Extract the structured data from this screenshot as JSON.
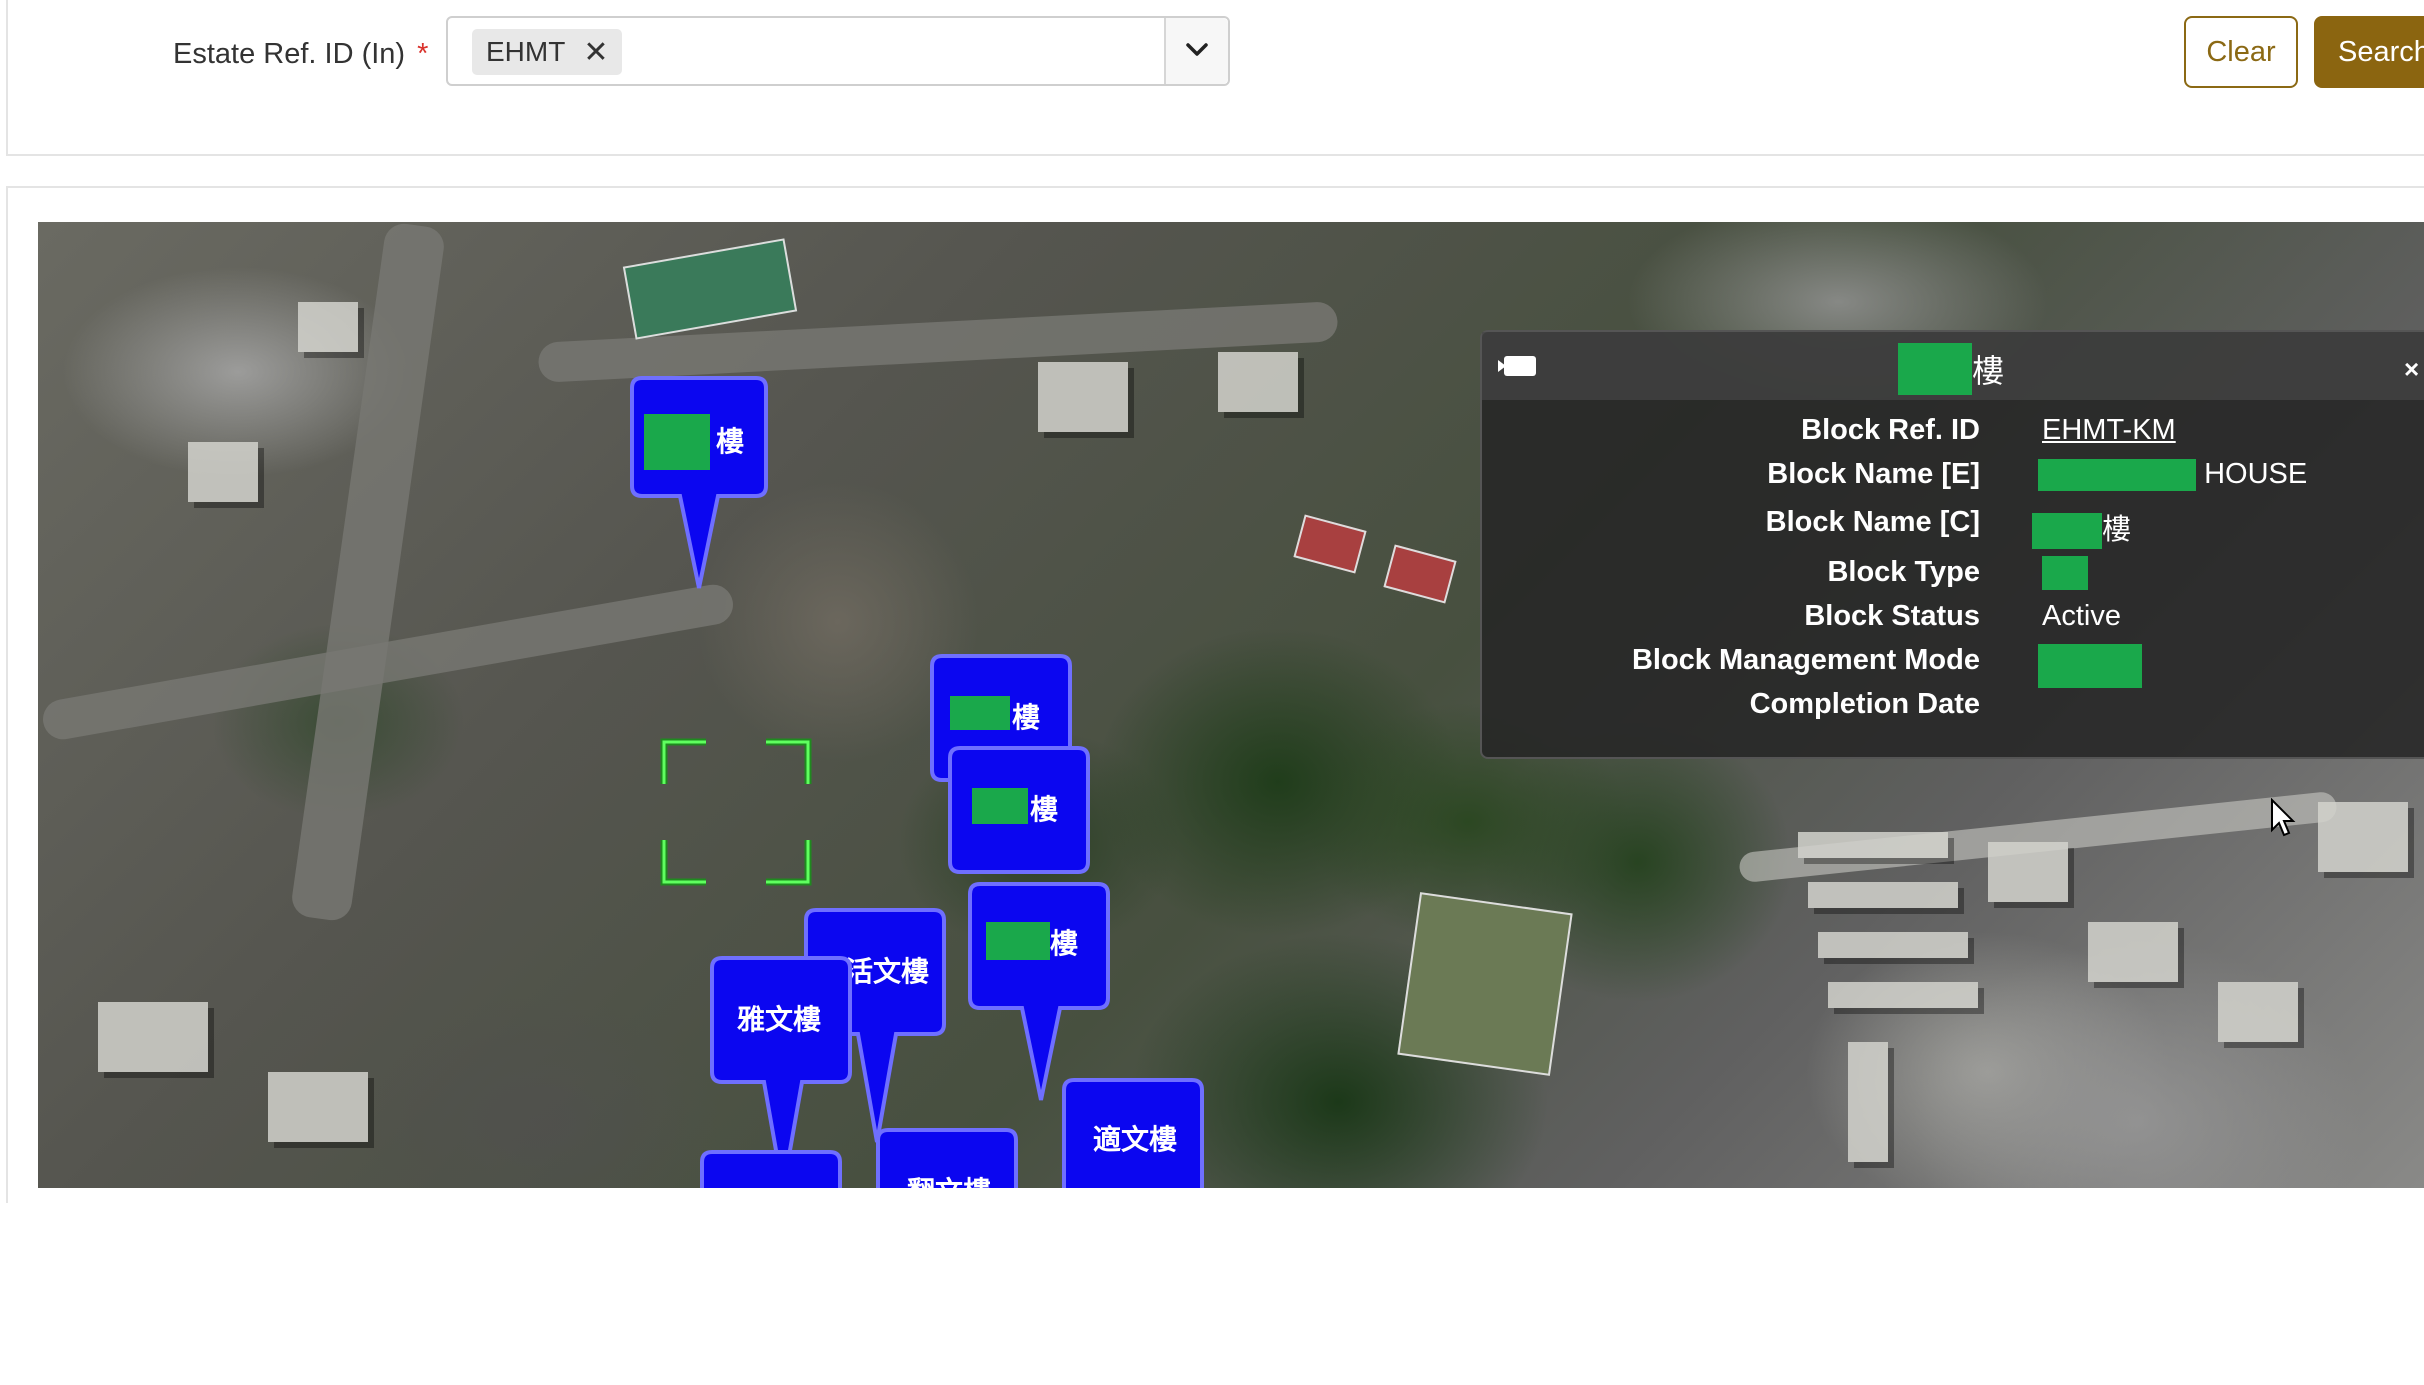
{
  "filter": {
    "label": "Estate Ref. ID (In)",
    "required_mark": "*",
    "selected_chip": "EHMT",
    "chip_remove": "✕",
    "dropdown_icon": "chevron-down-icon"
  },
  "buttons": {
    "clear": "Clear",
    "search": "Search"
  },
  "map": {
    "pins": [
      {
        "label": "樓"
      },
      {
        "label": "樓"
      },
      {
        "label": "樓"
      },
      {
        "label": "樓"
      },
      {
        "label": "活文樓"
      },
      {
        "label": "雅文樓"
      },
      {
        "label": "適文樓"
      },
      {
        "label": "翻文樓"
      }
    ],
    "info_popup": {
      "title_suffix": "樓",
      "close": "×",
      "fields": {
        "block_ref_id": {
          "label": "Block Ref. ID",
          "value": "EHMT-KM"
        },
        "block_name_e": {
          "label": "Block Name [E]",
          "value": "HOUSE"
        },
        "block_name_c": {
          "label": "Block Name [C]",
          "value": "樓"
        },
        "block_type": {
          "label": "Block Type",
          "value": ""
        },
        "block_status": {
          "label": "Block Status",
          "value": "Active"
        },
        "block_mgmt_mode": {
          "label": "Block Management Mode",
          "value": ""
        },
        "completion_date": {
          "label": "Completion Date",
          "value": ""
        }
      }
    }
  },
  "colors": {
    "accent_gold": "#8b6510",
    "pin_blue": "#0b06f0",
    "redaction_green": "#1aa84b",
    "required_red": "#d9322c"
  }
}
